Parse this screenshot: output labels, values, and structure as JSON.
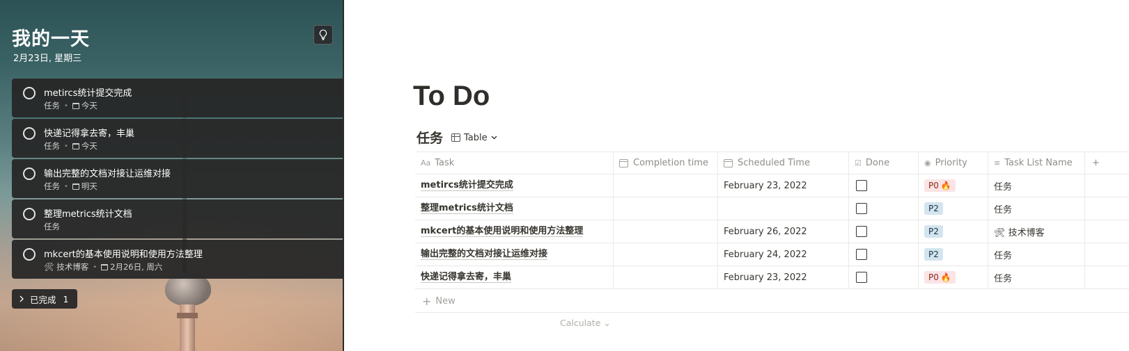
{
  "myday": {
    "title": "我的一天",
    "date": "2月23日, 星期三",
    "tasks": [
      {
        "title": "metircs统计提交完成",
        "list": "任务",
        "due": "今天"
      },
      {
        "title": "快递记得拿去寄，丰巢",
        "list": "任务",
        "due": "今天"
      },
      {
        "title": "输出完整的文档对接让运维对接",
        "list": "任务",
        "due": "明天"
      },
      {
        "title": "整理metrics统计文档",
        "list": "任务",
        "due": ""
      },
      {
        "title": "mkcert的基本使用说明和使用方法整理",
        "list": "🛠 技术博客",
        "due": "2月26日, 周六"
      }
    ],
    "completed_label": "已完成",
    "completed_count": "1"
  },
  "notion": {
    "page_title": "To Do",
    "database_title": "任务",
    "view_label": "Table",
    "columns": {
      "task": "Task",
      "completion": "Completion time",
      "scheduled": "Scheduled Time",
      "done": "Done",
      "priority": "Priority",
      "list": "Task List Name"
    },
    "rows": [
      {
        "task": "metircs统计提交完成",
        "completion": "",
        "scheduled": "February 23, 2022",
        "done": false,
        "priority": "P0",
        "hot": true,
        "list": "任务"
      },
      {
        "task": "整理metrics统计文档",
        "completion": "",
        "scheduled": "",
        "done": false,
        "priority": "P2",
        "hot": false,
        "list": "任务"
      },
      {
        "task": "mkcert的基本使用说明和使用方法整理",
        "completion": "",
        "scheduled": "February 26, 2022",
        "done": false,
        "priority": "P2",
        "hot": false,
        "list": "🛠 技术博客"
      },
      {
        "task": "输出完整的文档对接让运维对接",
        "completion": "",
        "scheduled": "February 24, 2022",
        "done": false,
        "priority": "P2",
        "hot": false,
        "list": "任务"
      },
      {
        "task": "快递记得拿去寄，丰巢",
        "completion": "",
        "scheduled": "February 23, 2022",
        "done": false,
        "priority": "P0",
        "hot": true,
        "list": "任务"
      }
    ],
    "new_label": "New",
    "calculate_label": "Calculate"
  },
  "colors": {
    "p0_bg": "#fbe4e4",
    "p2_bg": "#d3e5ef",
    "card_bg": "#262626"
  }
}
